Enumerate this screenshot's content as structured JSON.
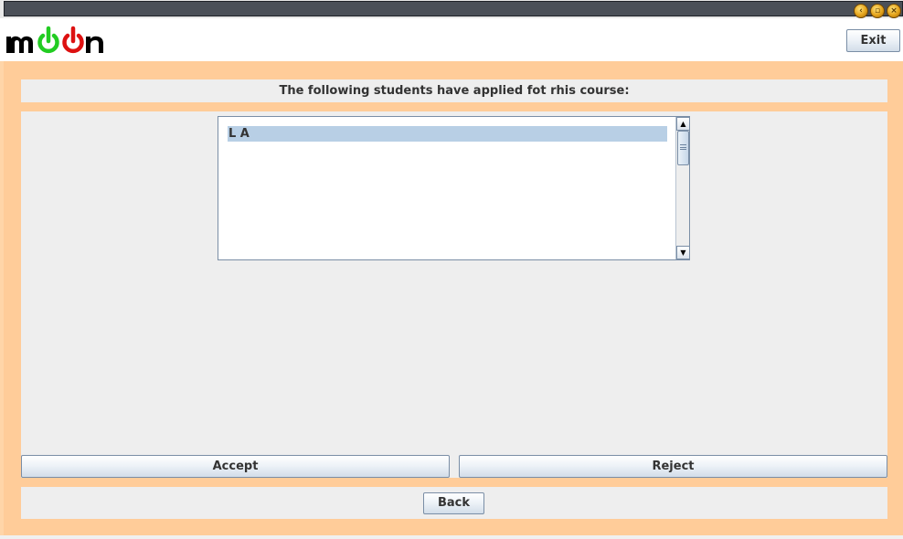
{
  "window": {
    "controls": [
      "minimize-icon",
      "maximize-icon",
      "close-icon"
    ]
  },
  "header": {
    "logo_text": "moon",
    "exit_label": "Exit"
  },
  "main": {
    "heading": "The following students have applied fot rhis course:",
    "applicants": [
      "L A"
    ],
    "selected_applicant": "L A",
    "accept_label": "Accept",
    "reject_label": "Reject",
    "back_label": "Back"
  },
  "colors": {
    "frame": "#ffcc99",
    "panel": "#eeeeee",
    "selection": "#b8cfe5",
    "logo_green": "#22cc22",
    "logo_red": "#dd1111",
    "titlebar": "#4b5058"
  }
}
